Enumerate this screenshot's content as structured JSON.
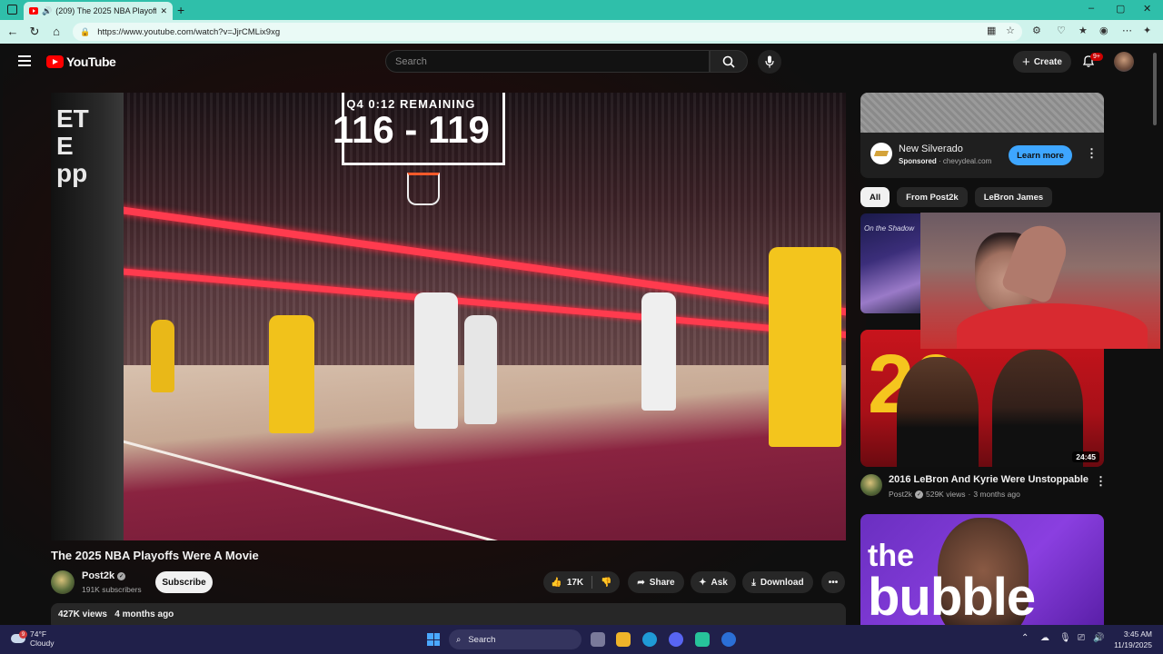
{
  "browser": {
    "tab_title": "(209) The 2025 NBA Playoffs",
    "url": "https://www.youtube.com/watch?v=JjrCMLix9xg",
    "window_controls": {
      "minimize": "‒",
      "maximize": "▢",
      "close": "✕"
    }
  },
  "header": {
    "logo_text": "YouTube",
    "search_placeholder": "Search",
    "create_label": "Create",
    "notification_count": "9+"
  },
  "video": {
    "scoreboard_time": "Q4 0:12 REMAINING",
    "scoreboard_score": "116 - 119",
    "title": "The 2025 NBA Playoffs Were A Movie",
    "channel": "Post2k",
    "subscribers": "191K subscribers",
    "subscribe_label": "Subscribe",
    "likes": "17K",
    "share_label": "Share",
    "ask_label": "Ask",
    "download_label": "Download",
    "views": "427K views",
    "age": "4 months ago"
  },
  "ad": {
    "title": "New Silverado",
    "sponsored": "Sponsored",
    "domain": "chevydeal.com",
    "cta": "Learn more"
  },
  "chips": [
    "All",
    "From Post2k",
    "LeBron James"
  ],
  "related": [
    {
      "thumb_text": "On the Shadow"
    },
    {
      "title": "2016 LeBron And Kyrie Were Unstoppable",
      "channel": "Post2k",
      "views": "529K views",
      "age": "3 months ago",
      "duration": "24:45",
      "thumb_text": "20"
    },
    {
      "thumb_text_1": "the",
      "thumb_text_2": "bubble"
    }
  ],
  "taskbar": {
    "temperature": "74°F",
    "condition": "Cloudy",
    "weather_badge": "9",
    "search_label": "Search",
    "time": "3:45 AM",
    "date": "11/19/2025"
  },
  "colors": {
    "tab_bar": "#2fbfaa",
    "address_bar": "#cff3ec",
    "youtube_red": "#ff0000",
    "learn_more": "#3ea6ff",
    "taskbar": "#20204a"
  }
}
